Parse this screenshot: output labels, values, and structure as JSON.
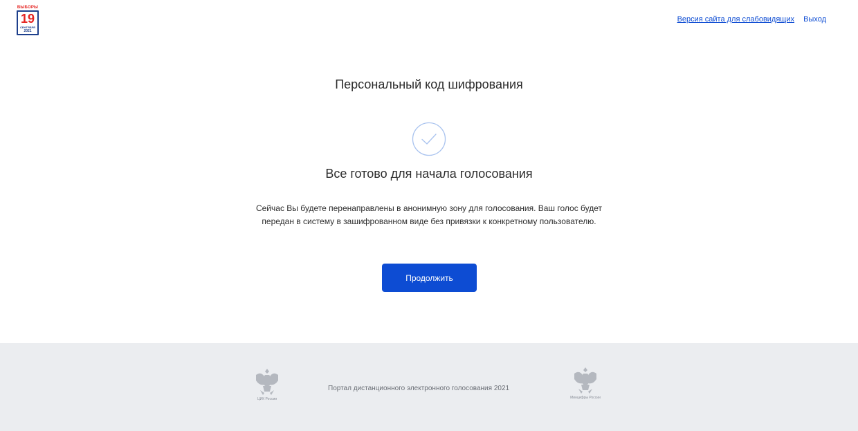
{
  "header": {
    "logo": {
      "top_text": "ВЫБОРЫ",
      "day": "19",
      "month": "СЕНТЯБРЯ",
      "year": "2021"
    },
    "links": {
      "impaired_version": "Версия сайта для слабовидящих",
      "logout": "Выход"
    }
  },
  "main": {
    "title": "Персональный код шифрования",
    "icon": "check-circle-icon",
    "subtitle": "Все готово для начала голосования",
    "description": "Сейчас Вы будете перенаправлены в анонимную зону для голосования. Ваш голос будет передан в систему в зашифрованном виде без привязки к конкретному пользователю.",
    "continue_label": "Продолжить"
  },
  "footer": {
    "left_emblem_caption": "ЦИК России",
    "portal_text": "Портал дистанционного электронного голосования 2021",
    "right_emblem_caption": "Минцифры России"
  },
  "colors": {
    "accent": "#0d4cd3",
    "footer_bg": "#ebedf0",
    "logo_red": "#e52421",
    "logo_blue": "#1d3f8c"
  }
}
